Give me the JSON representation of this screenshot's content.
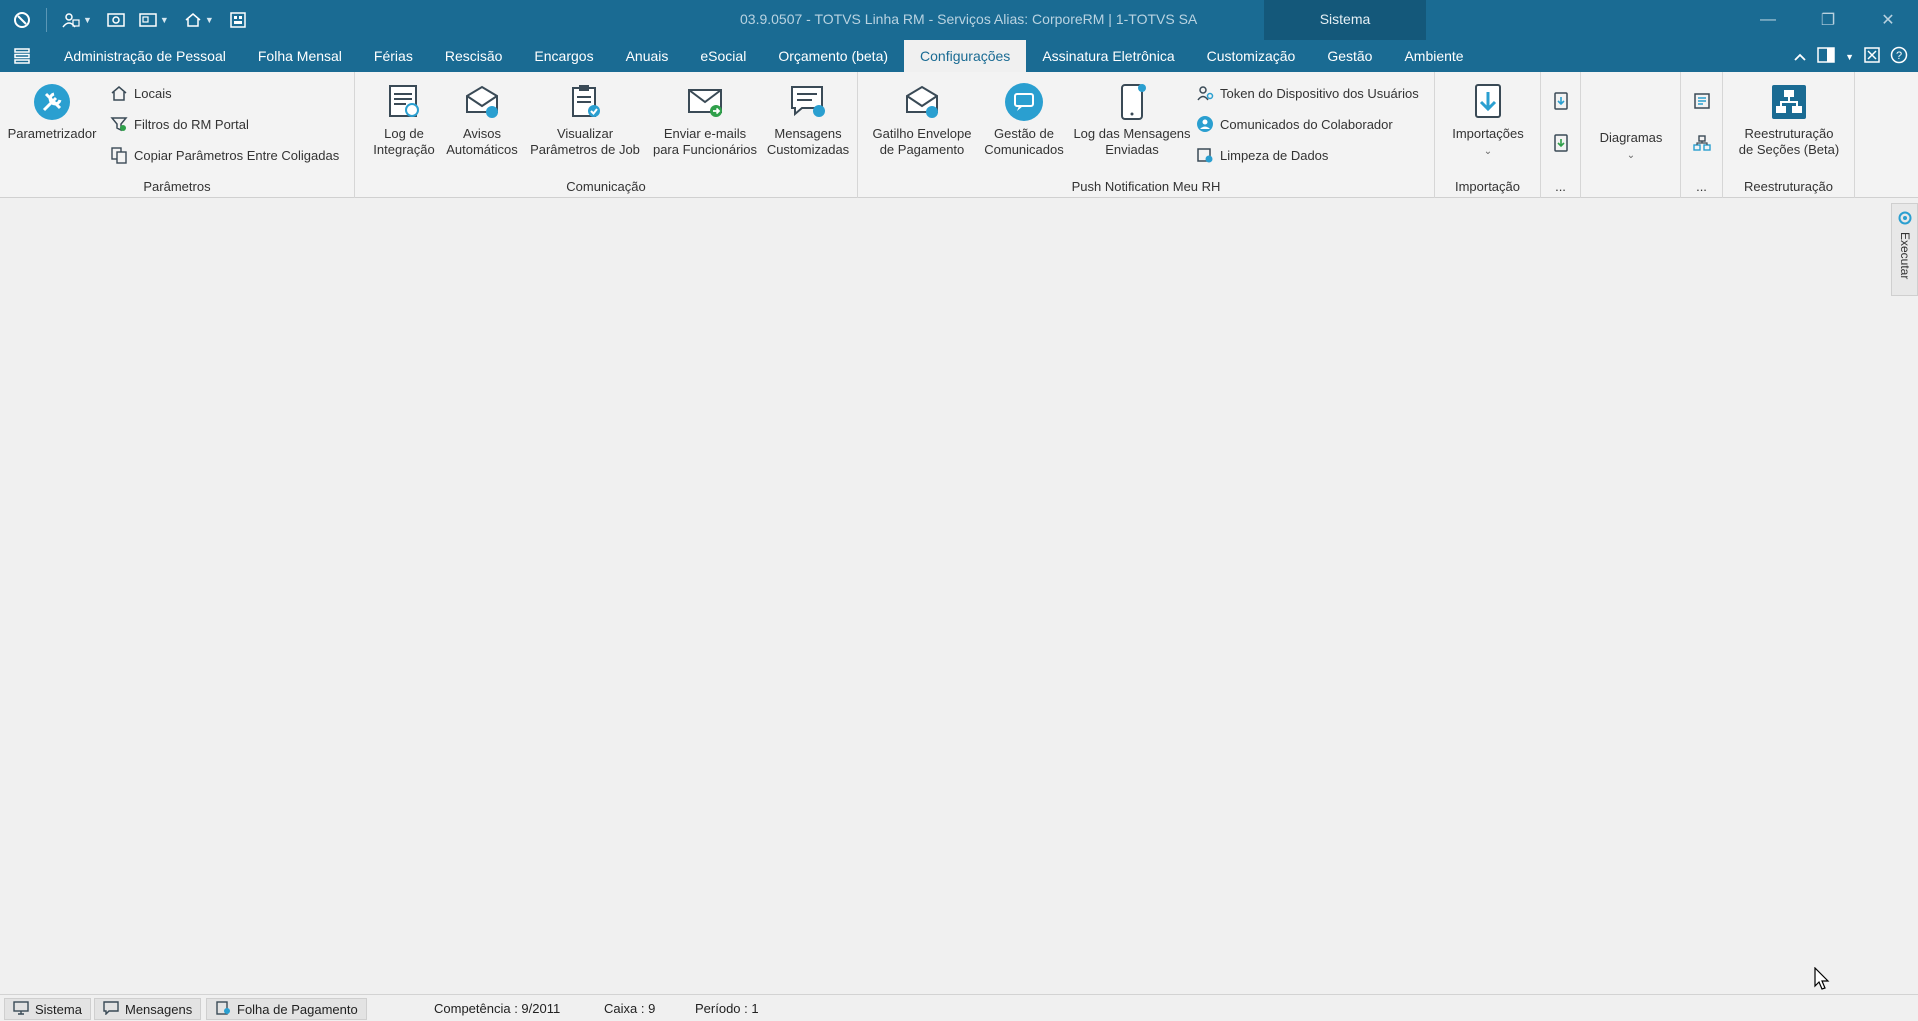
{
  "titlebar": {
    "title": "03.9.0507 - TOTVS Linha RM - Serviços  Alias: CorporeRM | 1-TOTVS SA",
    "context_tab": "Sistema"
  },
  "menu": {
    "tabs": [
      "Administração de Pessoal",
      "Folha Mensal",
      "Férias",
      "Rescisão",
      "Encargos",
      "Anuais",
      "eSocial",
      "Orçamento (beta)",
      "Configurações",
      "Assinatura Eletrônica",
      "Customização",
      "Gestão",
      "Ambiente"
    ],
    "active": "Configurações"
  },
  "ribbon": {
    "parametros": {
      "label": "Parâmetros",
      "parametrizador": "Parametrizador",
      "locais": "Locais",
      "filtros": "Filtros do RM Portal",
      "copiar": "Copiar Parâmetros Entre Coligadas"
    },
    "comunicacao": {
      "label": "Comunicação",
      "log_integracao": [
        "Log de",
        "Integração"
      ],
      "avisos": [
        "Avisos",
        "Automáticos"
      ],
      "visualizar": [
        "Visualizar",
        "Parâmetros de Job"
      ],
      "enviar": [
        "Enviar e-mails",
        "para Funcionários"
      ],
      "mensagens": [
        "Mensagens",
        "Customizadas"
      ]
    },
    "push": {
      "label": "Push Notification Meu RH",
      "gatilho": [
        "Gatilho Envelope",
        "de Pagamento"
      ],
      "gestao": [
        "Gestão de",
        "Comunicados"
      ],
      "log_mensagens": [
        "Log das Mensagens",
        "Enviadas"
      ],
      "token": "Token do Dispositivo dos Usuários",
      "comunicados": "Comunicados do Colaborador",
      "limpeza": "Limpeza de Dados"
    },
    "importacao": {
      "label": "Importação",
      "importacoes": "Importações"
    },
    "more1": {
      "label": "..."
    },
    "diagramas": {
      "label": "Diagramas"
    },
    "more2": {
      "label": "..."
    },
    "reestruturacao": {
      "label": "Reestruturação",
      "btn": [
        "Reestruturação",
        "de Seções (Beta)"
      ]
    }
  },
  "side_panel": {
    "label": "Executar"
  },
  "statusbar": {
    "sistema": "Sistema",
    "mensagens": "Mensagens",
    "folha": "Folha de Pagamento",
    "competencia": "Competência : 9/2011",
    "caixa": "Caixa : 9",
    "periodo": "Período : 1"
  },
  "colors": {
    "brand": "#1a6b93",
    "context": "#14587a",
    "ribbon_bg": "#f3f3f3",
    "icon": "#3a4a56",
    "accent": "#2a9fd0",
    "green": "#2fa04a"
  }
}
